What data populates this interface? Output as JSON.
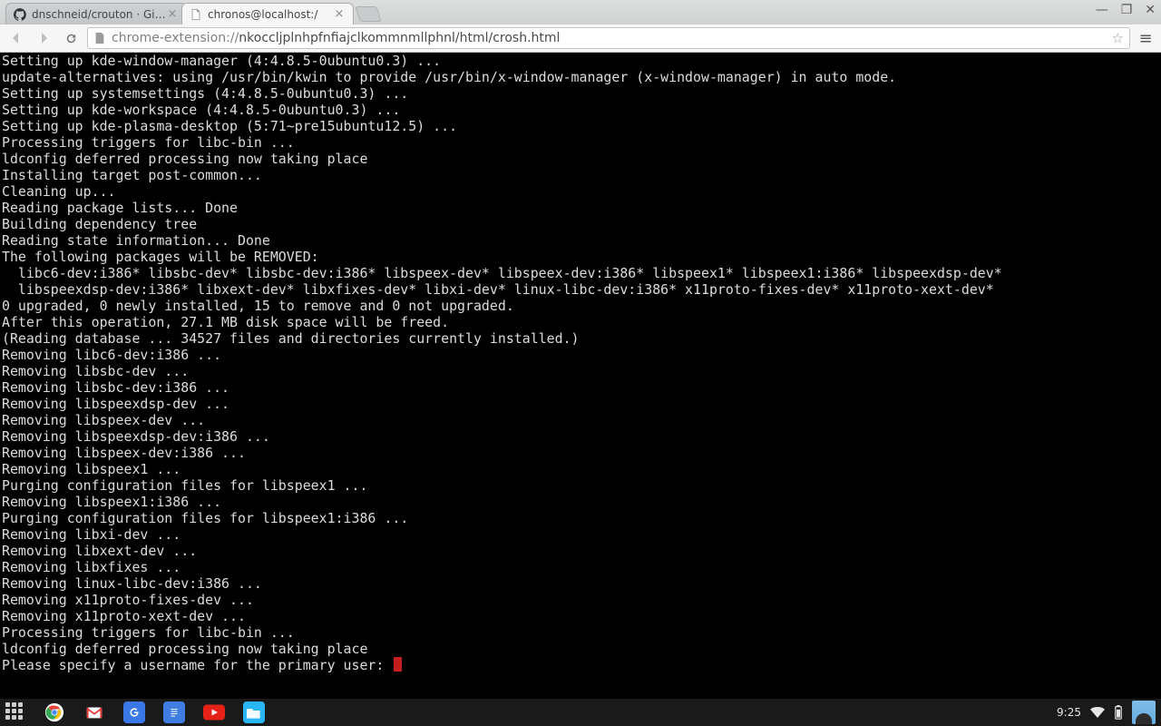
{
  "window": {
    "tabs": [
      {
        "title": "dnschneid/crouton · GitH",
        "active": false,
        "favicon": "github"
      },
      {
        "title": "chronos@localhost:/",
        "active": true,
        "favicon": "page"
      }
    ],
    "controls": {
      "min": "—",
      "max": "❐",
      "close": "✕"
    }
  },
  "toolbar": {
    "url_scheme": "chrome-extension://",
    "url_rest": "nkoccljplnhpfnfiajclkommnmllphnl/html/crosh.html"
  },
  "terminal": {
    "lines": [
      "Setting up kde-window-manager (4:4.8.5-0ubuntu0.3) ...",
      "update-alternatives: using /usr/bin/kwin to provide /usr/bin/x-window-manager (x-window-manager) in auto mode.",
      "Setting up systemsettings (4:4.8.5-0ubuntu0.3) ...",
      "Setting up kde-workspace (4:4.8.5-0ubuntu0.3) ...",
      "Setting up kde-plasma-desktop (5:71~pre15ubuntu12.5) ...",
      "Processing triggers for libc-bin ...",
      "ldconfig deferred processing now taking place",
      "Installing target post-common...",
      "Cleaning up...",
      "Reading package lists... Done",
      "Building dependency tree",
      "Reading state information... Done",
      "The following packages will be REMOVED:",
      "  libc6-dev:i386* libsbc-dev* libsbc-dev:i386* libspeex-dev* libspeex-dev:i386* libspeex1* libspeex1:i386* libspeexdsp-dev*",
      "  libspeexdsp-dev:i386* libxext-dev* libxfixes-dev* libxi-dev* linux-libc-dev:i386* x11proto-fixes-dev* x11proto-xext-dev*",
      "0 upgraded, 0 newly installed, 15 to remove and 0 not upgraded.",
      "After this operation, 27.1 MB disk space will be freed.",
      "(Reading database ... 34527 files and directories currently installed.)",
      "Removing libc6-dev:i386 ...",
      "Removing libsbc-dev ...",
      "Removing libsbc-dev:i386 ...",
      "Removing libspeexdsp-dev ...",
      "Removing libspeex-dev ...",
      "Removing libspeexdsp-dev:i386 ...",
      "Removing libspeex-dev:i386 ...",
      "Removing libspeex1 ...",
      "Purging configuration files for libspeex1 ...",
      "Removing libspeex1:i386 ...",
      "Purging configuration files for libspeex1:i386 ...",
      "Removing libxi-dev ...",
      "Removing libxext-dev ...",
      "Removing libxfixes ...",
      "Removing linux-libc-dev:i386 ...",
      "Removing x11proto-fixes-dev ...",
      "Removing x11proto-xext-dev ...",
      "Processing triggers for libc-bin ...",
      "ldconfig deferred processing now taking place"
    ],
    "prompt": "Please specify a username for the primary user: "
  },
  "shelf": {
    "clock": "9:25",
    "icons": [
      "apps",
      "chrome",
      "gmail",
      "search",
      "docs",
      "youtube",
      "files"
    ]
  }
}
